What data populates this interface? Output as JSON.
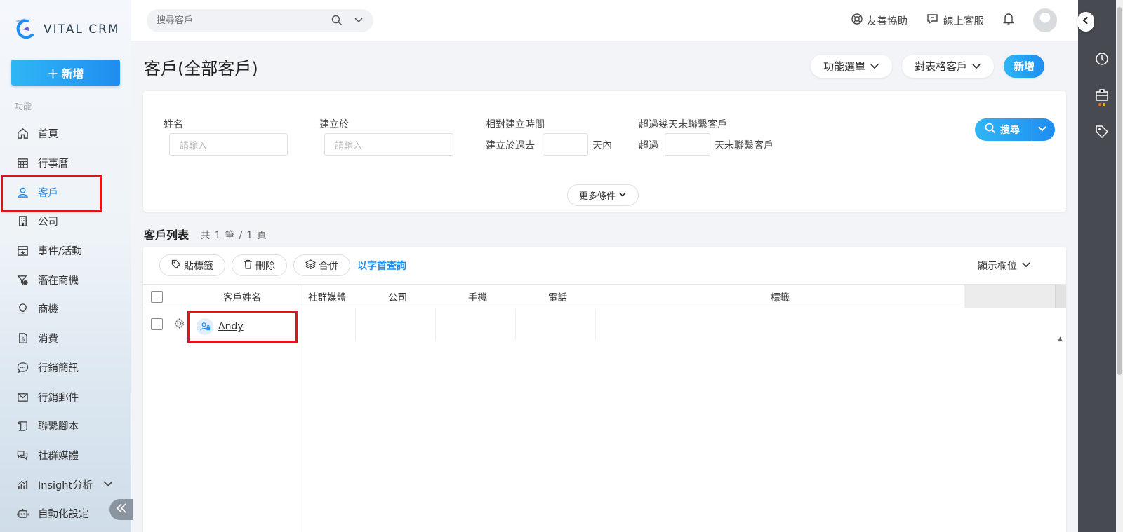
{
  "app": {
    "brand": "VITAL CRM"
  },
  "sidebar": {
    "new_label": "新增",
    "section_label": "功能",
    "items": [
      {
        "label": "首頁",
        "icon": "home-icon"
      },
      {
        "label": "行事曆",
        "icon": "calendar-icon"
      },
      {
        "label": "客戶",
        "icon": "user-icon"
      },
      {
        "label": "公司",
        "icon": "building-icon"
      },
      {
        "label": "事件/活動",
        "icon": "event-icon"
      },
      {
        "label": "潛在商機",
        "icon": "funnel-icon"
      },
      {
        "label": "商機",
        "icon": "lightbulb-icon"
      },
      {
        "label": "消費",
        "icon": "receipt-icon"
      },
      {
        "label": "行銷簡訊",
        "icon": "sms-icon"
      },
      {
        "label": "行銷郵件",
        "icon": "mail-icon"
      },
      {
        "label": "聯繫腳本",
        "icon": "script-icon"
      },
      {
        "label": "社群媒體",
        "icon": "chat-icon"
      },
      {
        "label": "Insight分析",
        "icon": "analytics-icon"
      },
      {
        "label": "自動化設定",
        "icon": "robot-icon"
      }
    ],
    "active_index": 2
  },
  "topbar": {
    "search_placeholder": "搜尋客戶",
    "help_label": "友善協助",
    "support_label": "線上客服"
  },
  "page": {
    "title": "客戶(全部客戶)",
    "menu_label": "功能選單",
    "table_view_label": "對表格客戶",
    "new_label": "新增"
  },
  "filters": {
    "name_label": "姓名",
    "name_placeholder": "請輸入",
    "created_label": "建立於",
    "created_placeholder": "請輸入",
    "relative_label": "相對建立時間",
    "relative_prefix": "建立於過去",
    "relative_suffix": "天內",
    "uncontacted_label": "超過幾天未聯繫客戶",
    "uncontacted_prefix": "超過",
    "uncontacted_suffix": "天未聯繫客戶",
    "search_label": "搜尋",
    "more_label": "更多條件"
  },
  "list": {
    "title": "客戶列表",
    "count": "共 1 筆 / 1 頁",
    "tag_btn": "貼標籤",
    "delete_btn": "刪除",
    "merge_btn": "合併",
    "initial_search": "以字首查詢",
    "display_cols": "顯示欄位",
    "columns": [
      "客戶姓名",
      "社群媒體",
      "公司",
      "手機",
      "電話",
      "標籤"
    ],
    "rows": [
      {
        "name": "Andy"
      }
    ]
  },
  "colors": {
    "accent": "#1f8df0",
    "highlight": "#e0141b",
    "rail": "#474b51"
  }
}
